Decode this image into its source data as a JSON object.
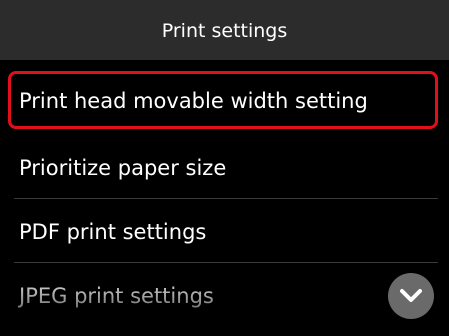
{
  "header": {
    "title": "Print settings"
  },
  "menu": {
    "items": [
      {
        "label": "Print head movable width setting",
        "selected": true
      },
      {
        "label": "Prioritize paper size",
        "selected": false
      },
      {
        "label": "PDF print settings",
        "selected": false
      },
      {
        "label": "JPEG print settings",
        "selected": false
      }
    ]
  },
  "colors": {
    "background": "#000000",
    "title_bar": "#2c2c2c",
    "selection_outline": "#e0101a",
    "scroll_button": "#6a6a6a"
  },
  "icons": {
    "scroll_down": "chevron-down-icon"
  }
}
